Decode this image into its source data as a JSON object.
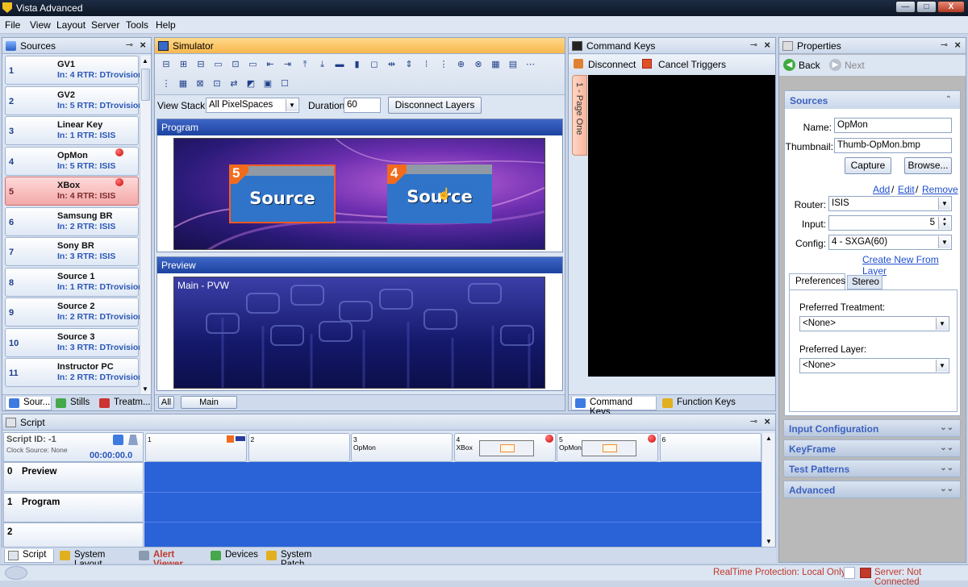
{
  "app": {
    "title": "Vista Advanced",
    "min_glyph": "—",
    "max_glyph": "□",
    "close_glyph": "X"
  },
  "menu": [
    "File",
    "View",
    "Layout",
    "Server",
    "Tools",
    "Help"
  ],
  "sources": {
    "title": "Sources",
    "items": [
      {
        "num": "1",
        "name": "GV1",
        "info": "In: 4 RTR: DTrovision"
      },
      {
        "num": "2",
        "name": "GV2",
        "info": "In: 5 RTR: DTrovision"
      },
      {
        "num": "3",
        "name": "Linear Key",
        "info": "In: 1 RTR: ISIS"
      },
      {
        "num": "4",
        "name": "OpMon",
        "info": "In: 5 RTR: ISIS"
      },
      {
        "num": "5",
        "name": "XBox",
        "info": "In: 4 RTR: ISIS"
      },
      {
        "num": "6",
        "name": "Samsung BR",
        "info": "In: 2 RTR: ISIS"
      },
      {
        "num": "7",
        "name": "Sony BR",
        "info": "In: 3 RTR: ISIS"
      },
      {
        "num": "8",
        "name": "Source 1",
        "info": "In: 1 RTR: DTrovision"
      },
      {
        "num": "9",
        "name": "Source 2",
        "info": "In: 2 RTR: DTrovision"
      },
      {
        "num": "10",
        "name": "Source 3",
        "info": "In: 3 RTR: DTrovision"
      },
      {
        "num": "11",
        "name": "Instructor PC",
        "info": "In: 2 RTR: DTrovision"
      }
    ],
    "tabs": [
      "Sour...",
      "Stills",
      "Treatm..."
    ]
  },
  "simulator": {
    "title": "Simulator",
    "view_stack_label": "View Stack:",
    "view_stack_value": "All PixelSpaces",
    "duration_label": "Duration",
    "duration_value": "60",
    "disconnect_layers": "Disconnect Layers",
    "program_label": "Program",
    "preview_label": "Preview",
    "preview_overlay": "Main - PVW",
    "layer_a_num": "5",
    "layer_a_text": "Source",
    "layer_b_num": "4",
    "layer_b_text": "Source",
    "bottom_tabs": [
      "All",
      "Main"
    ]
  },
  "command_keys": {
    "title": "Command Keys",
    "disconnect": "Disconnect",
    "cancel_triggers": "Cancel Triggers",
    "page_tab": "1 - Page One",
    "bottom_tabs": [
      "Command Keys",
      "Function Keys"
    ]
  },
  "properties": {
    "title": "Properties",
    "back": "Back",
    "next": "Next",
    "section": "Sources",
    "name_label": "Name:",
    "name_value": "OpMon",
    "thumb_label": "Thumbnail:",
    "thumb_value": "Thumb-OpMon.bmp",
    "capture": "Capture",
    "browse": "Browse...",
    "add": "Add",
    "edit": "Edit",
    "remove": "Remove",
    "link_sep": "/",
    "router_label": "Router:",
    "router_value": "ISIS",
    "input_label": "Input:",
    "input_value": "5",
    "config_label": "Config:",
    "config_value": "4 - SXGA(60)",
    "create_new": "Create New From Layer",
    "tabs": [
      "Preferences",
      "Stereo"
    ],
    "pref_treatment_label": "Preferred Treatment:",
    "pref_treatment_value": "<None>",
    "pref_layer_label": "Preferred Layer:",
    "pref_layer_value": "<None>",
    "sections": [
      "Input Configuration",
      "KeyFrame",
      "Test Patterns",
      "Advanced"
    ]
  },
  "script": {
    "title": "Script",
    "script_id": "Script ID: -1",
    "clock_source": "Clock Source: None",
    "time": "00:00:00.0",
    "columns": [
      {
        "num": "1",
        "name": ""
      },
      {
        "num": "2",
        "name": ""
      },
      {
        "num": "3",
        "name": "OpMon"
      },
      {
        "num": "4",
        "name": "XBox"
      },
      {
        "num": "5",
        "name": "OpMon"
      },
      {
        "num": "6",
        "name": ""
      }
    ],
    "rows": [
      {
        "num": "0",
        "name": "Preview"
      },
      {
        "num": "1",
        "name": "Program"
      },
      {
        "num": "2",
        "name": ""
      }
    ],
    "bottom_tabs": [
      "Script",
      "System Layout",
      "Alert Viewer",
      "Devices",
      "System Patch"
    ]
  },
  "status": {
    "realtime": "RealTime Protection: Local Only",
    "server": "Server: Not Connected"
  },
  "colors": {
    "accent": "#2a55b8",
    "script_fill": "#2a62d8",
    "alert": "#c0392b"
  }
}
